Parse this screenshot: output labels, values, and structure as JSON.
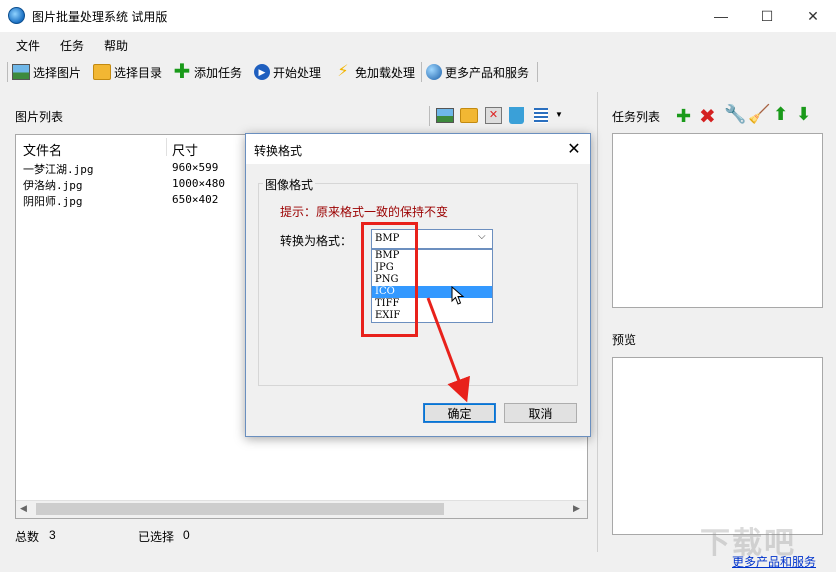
{
  "window": {
    "title": "图片批量处理系统 试用版",
    "controls": {
      "minimize": "—",
      "maximize": "☐",
      "close": "✕"
    }
  },
  "menu": [
    "文件",
    "任务",
    "帮助"
  ],
  "toolbar": [
    {
      "label": "选择图片",
      "icon": "image-icon"
    },
    {
      "label": "选择目录",
      "icon": "folder-icon"
    },
    {
      "label": "添加任务",
      "icon": "plus-icon"
    },
    {
      "label": "开始处理",
      "icon": "play-icon"
    },
    {
      "label": "免加载处理",
      "icon": "lightning-icon"
    },
    {
      "label": "更多产品和服务",
      "icon": "globe-icon"
    }
  ],
  "image_list": {
    "title": "图片列表",
    "columns": [
      "文件名",
      "尺寸"
    ],
    "rows": [
      {
        "name": "一梦江湖.jpg",
        "size": "960×599"
      },
      {
        "name": "伊洛纳.jpg",
        "size": "1000×480"
      },
      {
        "name": "阴阳师.jpg",
        "size": "650×402"
      }
    ]
  },
  "status": {
    "total_label": "总数",
    "total": "3",
    "selected_label": "已选择",
    "selected": "0"
  },
  "task_list": {
    "title": "任务列表"
  },
  "preview": {
    "title": "预览"
  },
  "more_link": "更多产品和服务",
  "dialog": {
    "title": "转换格式",
    "close": "✕",
    "group_title": "图像格式",
    "hint": "提示：原来格式一致的保持不变",
    "convert_label": "转换为格式：",
    "selected_value": "BMP",
    "options": [
      "BMP",
      "JPG",
      "PNG",
      "ICO",
      "TIFF",
      "EXIF"
    ],
    "highlighted_option": "ICO",
    "ok": "确定",
    "cancel": "取消"
  },
  "colors": {
    "highlight": "#3399ff",
    "annotation_red": "#e8211b",
    "hint_text": "#9b0000",
    "link": "#0033cc"
  }
}
